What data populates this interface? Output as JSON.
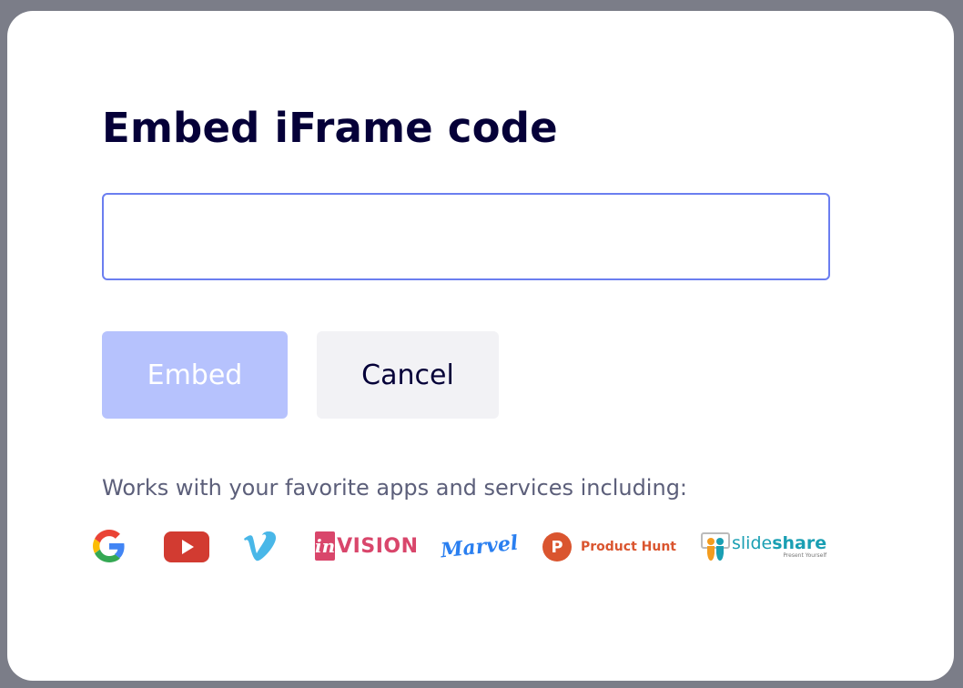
{
  "dialog": {
    "title": "Embed iFrame code",
    "input": {
      "value": "",
      "placeholder": ""
    },
    "embed_label": "Embed",
    "cancel_label": "Cancel",
    "works_with": "Works with your favorite apps and services including:"
  },
  "services": {
    "google_icon": "google-icon",
    "youtube_icon": "youtube-icon",
    "vimeo_icon": "vimeo-icon",
    "invision": {
      "mark": "in",
      "word": "VISION"
    },
    "marvel": {
      "word": "Marvel"
    },
    "product_hunt": {
      "mark": "P",
      "word": "Product Hunt"
    },
    "slideshare": {
      "part1": "slide",
      "part2": "share",
      "tagline": "Present Yourself"
    }
  },
  "colors": {
    "accent": "#6b7ef0",
    "embed_button_bg": "#b6c2fd",
    "cancel_button_bg": "#f2f2f5",
    "title_text": "#050038",
    "backdrop": "#7b7d88"
  }
}
